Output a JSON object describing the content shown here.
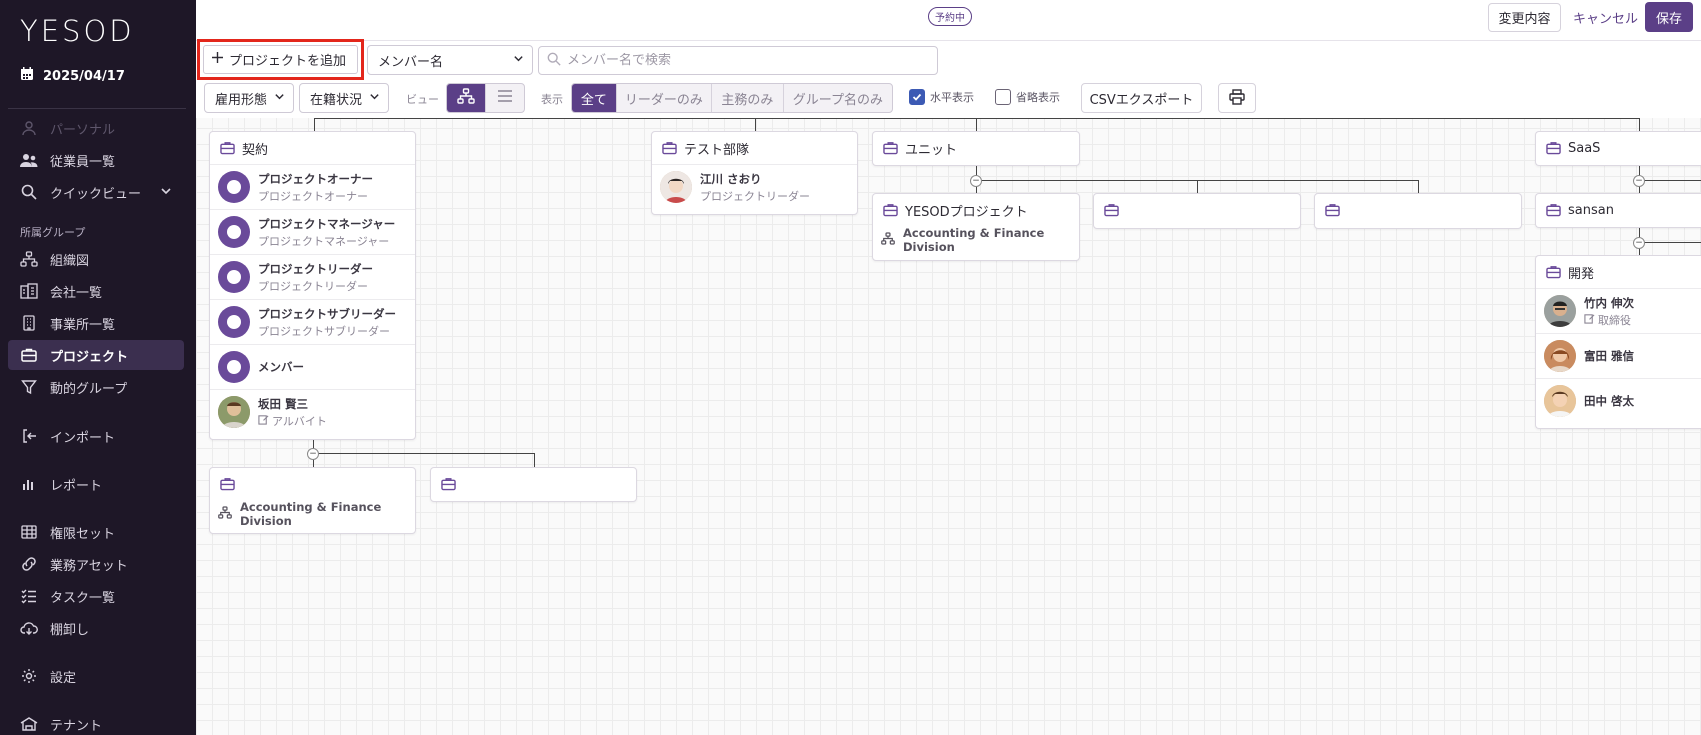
{
  "app": {
    "logo": "YESOD",
    "date": "2025/04/17"
  },
  "sidebar": {
    "items": [
      {
        "label": "パーソナル"
      },
      {
        "label": "従業員一覧"
      },
      {
        "label": "クイックビュー"
      },
      {
        "label": "組織図"
      },
      {
        "label": "会社一覧"
      },
      {
        "label": "事業所一覧"
      },
      {
        "label": "プロジェクト"
      },
      {
        "label": "動的グループ"
      },
      {
        "label": "インポート"
      },
      {
        "label": "レポート"
      },
      {
        "label": "権限セット"
      },
      {
        "label": "業務アセット"
      },
      {
        "label": "タスク一覧"
      },
      {
        "label": "棚卸し"
      },
      {
        "label": "設定"
      },
      {
        "label": "テナント"
      }
    ],
    "section_label": "所属グループ"
  },
  "header": {
    "status_badge": "予約中",
    "changes_label": "変更内容",
    "cancel_label": "キャンセル",
    "save_label": "保存"
  },
  "toolbar": {
    "add_project_label": "プロジェクトを追加",
    "member_select": "メンバー名",
    "search_placeholder": "メンバー名で検索",
    "employment_filter": "雇用形態",
    "status_filter": "在籍状況",
    "view_label": "ビュー",
    "display_label": "表示",
    "display_options": [
      "全て",
      "リーダーのみ",
      "主務のみ",
      "グループ名のみ"
    ],
    "horizontal_label": "水平表示",
    "horizontal_checked": true,
    "compact_label": "省略表示",
    "compact_checked": false,
    "csv_label": "CSVエクスポート"
  },
  "colors": {
    "brand": "#5b3f87",
    "sidebar": "#1e1727",
    "highlight": "#e3261b"
  },
  "chart": {
    "keiyaku": {
      "title": "契約",
      "members": [
        {
          "name": "プロジェクトオーナー",
          "role": "プロジェクトオーナー"
        },
        {
          "name": "プロジェクトマネージャー",
          "role": "プロジェクトマネージャー"
        },
        {
          "name": "プロジェクトリーダー",
          "role": "プロジェクトリーダー"
        },
        {
          "name": "プロジェクトサブリーダー",
          "role": "プロジェクトサブリーダー"
        },
        {
          "name": "メンバー",
          "role": ""
        },
        {
          "name": "坂田 賢三",
          "role": "アルバイト"
        }
      ]
    },
    "child_card_1": {
      "division": "Accounting & Finance Division"
    },
    "test_team": {
      "title": "テスト部隊",
      "member": {
        "name": "江川 さおり",
        "role": "プロジェクトリーダー"
      }
    },
    "unit": {
      "title": "ユニット"
    },
    "yesod_project": {
      "title": "YESODプロジェクト",
      "division": "Accounting & Finance Division"
    },
    "saas": {
      "title": "SaaS"
    },
    "sansan": {
      "title": "sansan"
    },
    "kaihatsu": {
      "title": "開発",
      "members": [
        {
          "name": "竹内 伸次",
          "role": "取締役"
        },
        {
          "name": "富田 雅信",
          "role": ""
        },
        {
          "name": "田中 啓太",
          "role": ""
        }
      ]
    }
  }
}
